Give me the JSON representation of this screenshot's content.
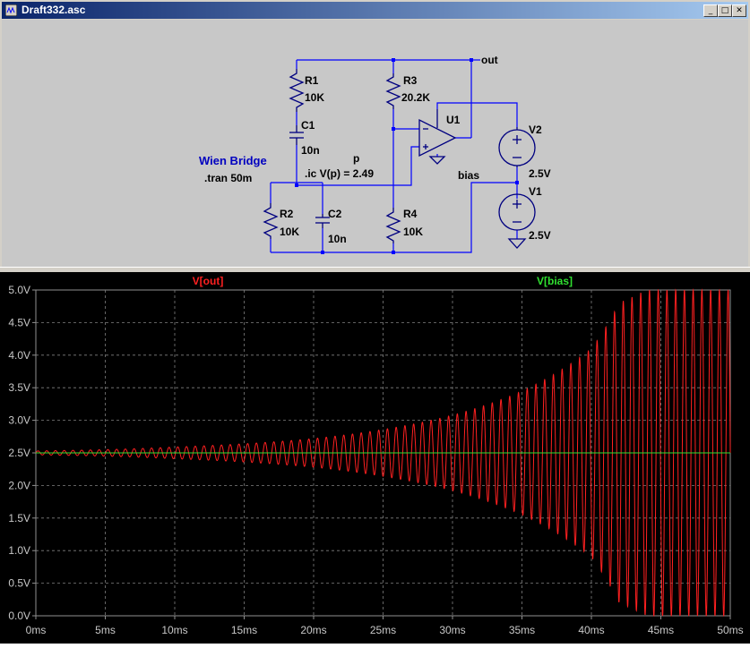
{
  "window": {
    "title": "Draft332.asc",
    "buttons": {
      "minimize": "_",
      "maximize": "□",
      "close": "✕"
    }
  },
  "schematic": {
    "title_label": "Wien Bridge",
    "tran_directive": ".tran 50m",
    "ic_directive": ".ic V(p) = 2.49",
    "net_labels": {
      "out": "out",
      "p": "p",
      "bias": "bias"
    },
    "components": {
      "R1": {
        "name": "R1",
        "value": "10K"
      },
      "C1": {
        "name": "C1",
        "value": "10n"
      },
      "R2": {
        "name": "R2",
        "value": "10K"
      },
      "C2": {
        "name": "C2",
        "value": "10n"
      },
      "R3": {
        "name": "R3",
        "value": "20.2K"
      },
      "R4": {
        "name": "R4",
        "value": "10K"
      },
      "U1": {
        "name": "U1"
      },
      "V2": {
        "name": "V2",
        "value": "2.5V"
      },
      "V1": {
        "name": "V1",
        "value": "2.5V"
      }
    },
    "colors": {
      "wire": "#0000ff",
      "component": "#000080",
      "directive": "#000000",
      "title": "#0000c0"
    }
  },
  "chart_data": {
    "type": "line",
    "title": "",
    "xlabel": "",
    "ylabel": "",
    "x_ticks": [
      "0ms",
      "5ms",
      "10ms",
      "15ms",
      "20ms",
      "25ms",
      "30ms",
      "35ms",
      "40ms",
      "45ms",
      "50ms"
    ],
    "y_ticks": [
      "0.0V",
      "0.5V",
      "1.0V",
      "1.5V",
      "2.0V",
      "2.5V",
      "3.0V",
      "3.5V",
      "4.0V",
      "4.5V",
      "5.0V"
    ],
    "xlim": [
      0,
      50
    ],
    "ylim": [
      0,
      5
    ],
    "grid": true,
    "legend_placement": "top",
    "series": [
      {
        "name": "V[out]",
        "color": "#ff2020",
        "kind": "growing-sine",
        "center": 2.5,
        "frequency_khz": 1.59,
        "envelope": [
          {
            "t": 0,
            "amp": 0.03
          },
          {
            "t": 5,
            "amp": 0.05
          },
          {
            "t": 10,
            "amp": 0.09
          },
          {
            "t": 15,
            "amp": 0.14
          },
          {
            "t": 20,
            "amp": 0.22
          },
          {
            "t": 25,
            "amp": 0.36
          },
          {
            "t": 30,
            "amp": 0.58
          },
          {
            "t": 35,
            "amp": 0.95
          },
          {
            "t": 40,
            "amp": 1.6
          },
          {
            "t": 42,
            "amp": 2.3
          },
          {
            "t": 44,
            "amp": 2.5
          },
          {
            "t": 50,
            "amp": 2.5
          }
        ]
      },
      {
        "name": "V[bias]",
        "color": "#30e030",
        "kind": "constant",
        "value": 2.5
      }
    ]
  }
}
